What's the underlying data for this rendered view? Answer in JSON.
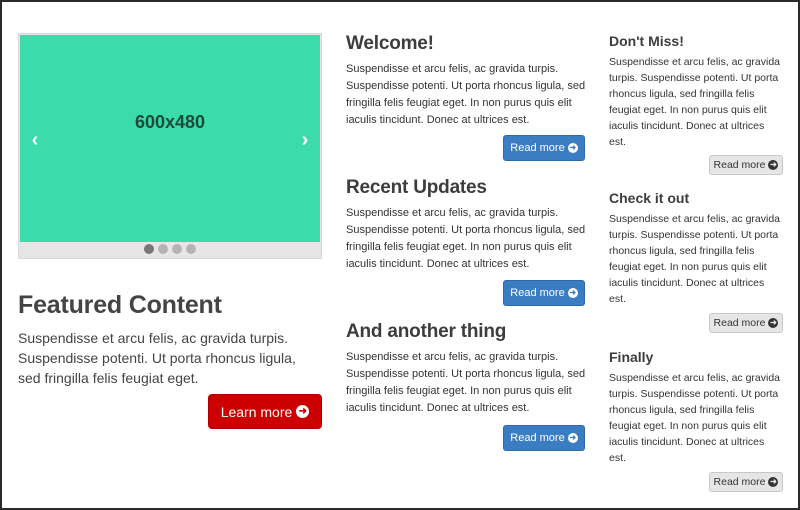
{
  "carousel": {
    "slide_label": "600x480",
    "prev_icon": "‹",
    "next_icon": "›",
    "indicator_count": 4,
    "active_index": 0,
    "slide_color": "#3bdbac"
  },
  "featured": {
    "title": "Featured Content",
    "text": "Suspendisse et arcu felis, ac gravida turpis. Suspendisse potenti. Ut porta rhoncus ligula, sed fringilla felis feugiat eget.",
    "button_label": "Learn more",
    "button_color": "#cc0000"
  },
  "middle": [
    {
      "title": "Welcome!",
      "text": "Suspendisse et arcu felis, ac gravida turpis. Suspendisse potenti. Ut porta rhoncus ligula, sed fringilla felis feugiat eget. In non purus quis elit iaculis tincidunt. Donec at ultrices est.",
      "button_label": "Read more"
    },
    {
      "title": "Recent Updates",
      "text": "Suspendisse et arcu felis, ac gravida turpis. Suspendisse potenti. Ut porta rhoncus ligula, sed fringilla felis feugiat eget. In non purus quis elit iaculis tincidunt. Donec at ultrices est.",
      "button_label": "Read more"
    },
    {
      "title": "And another thing",
      "text": "Suspendisse et arcu felis, ac gravida turpis. Suspendisse potenti. Ut porta rhoncus ligula, sed fringilla felis feugiat eget. In non purus quis elit iaculis tincidunt. Donec at ultrices est.",
      "button_label": "Read more"
    }
  ],
  "right": [
    {
      "title": "Don't Miss!",
      "text": "Suspendisse et arcu felis, ac gravida turpis. Suspendisse potenti. Ut porta rhoncus ligula, sed fringilla felis feugiat eget. In non purus quis elit iaculis tincidunt. Donec at ultrices est.",
      "button_label": "Read more"
    },
    {
      "title": "Check it out",
      "text": "Suspendisse et arcu felis, ac gravida turpis. Suspendisse potenti. Ut porta rhoncus ligula, sed fringilla felis feugiat eget. In non purus quis elit iaculis tincidunt. Donec at ultrices est.",
      "button_label": "Read more"
    },
    {
      "title": "Finally",
      "text": "Suspendisse et arcu felis, ac gravida turpis. Suspendisse potenti. Ut porta rhoncus ligula, sed fringilla felis feugiat eget. In non purus quis elit iaculis tincidunt. Donec at ultrices est.",
      "button_label": "Read more"
    }
  ],
  "icons": {
    "arrow_circle_right": "➜"
  },
  "colors": {
    "primary": "#3a7dc3",
    "danger": "#cc0000",
    "default_button": "#e6e6e6"
  }
}
